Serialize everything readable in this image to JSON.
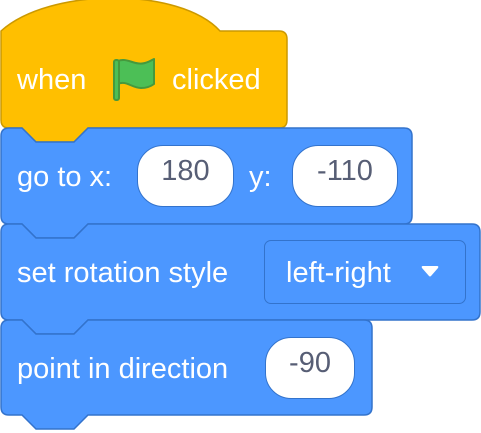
{
  "colors": {
    "events_fill": "#ffbf00",
    "events_stroke": "#cc9900",
    "motion_fill": "#4c97ff",
    "motion_stroke": "#3373cc",
    "input_text": "#575e75",
    "flag_green": "#4cbf56",
    "flag_dark": "#45993d"
  },
  "hat_block": {
    "when_label": "when",
    "flag_icon": "green-flag-icon",
    "clicked_label": "clicked"
  },
  "goto_block": {
    "label": "go to x:",
    "x_value": "180",
    "y_label": "y:",
    "y_value": "-110"
  },
  "rotation_block": {
    "label": "set rotation style",
    "selected_option": "left-right",
    "arrow_icon": "dropdown-arrow-icon"
  },
  "direction_block": {
    "label": "point in direction",
    "value": "-90"
  }
}
